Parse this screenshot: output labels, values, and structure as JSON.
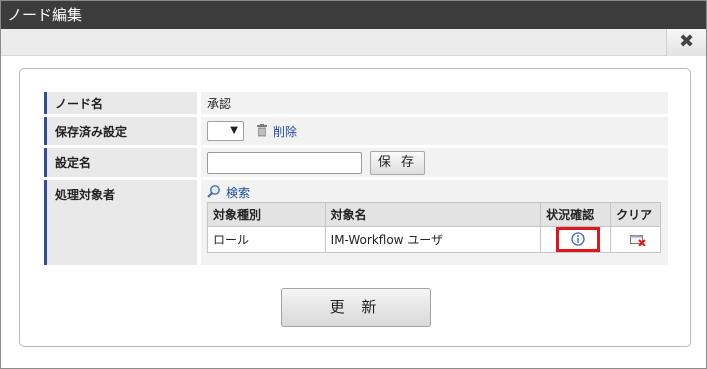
{
  "window": {
    "title": "ノード編集",
    "close_symbol": "✖"
  },
  "form": {
    "node_name": {
      "label": "ノード名",
      "value": "承認"
    },
    "saved_setting": {
      "label": "保存済み設定",
      "select_value": "",
      "delete_link": "削除"
    },
    "setting_name": {
      "label": "設定名",
      "input_value": "",
      "save_button": "保 存"
    },
    "targets": {
      "label": "処理対象者",
      "search_link": "検索",
      "table": {
        "headers": [
          "対象種別",
          "対象名",
          "状況確認",
          "クリア"
        ],
        "rows": [
          {
            "type": "ロール",
            "name": "IM-Workflow ユーザ"
          }
        ]
      }
    }
  },
  "update_button": "更 新",
  "colors": {
    "titlebar": "#3c3c3c",
    "label_accent": "#2f4f9a",
    "link": "#1a4c9c",
    "highlight": "#e0161b"
  }
}
